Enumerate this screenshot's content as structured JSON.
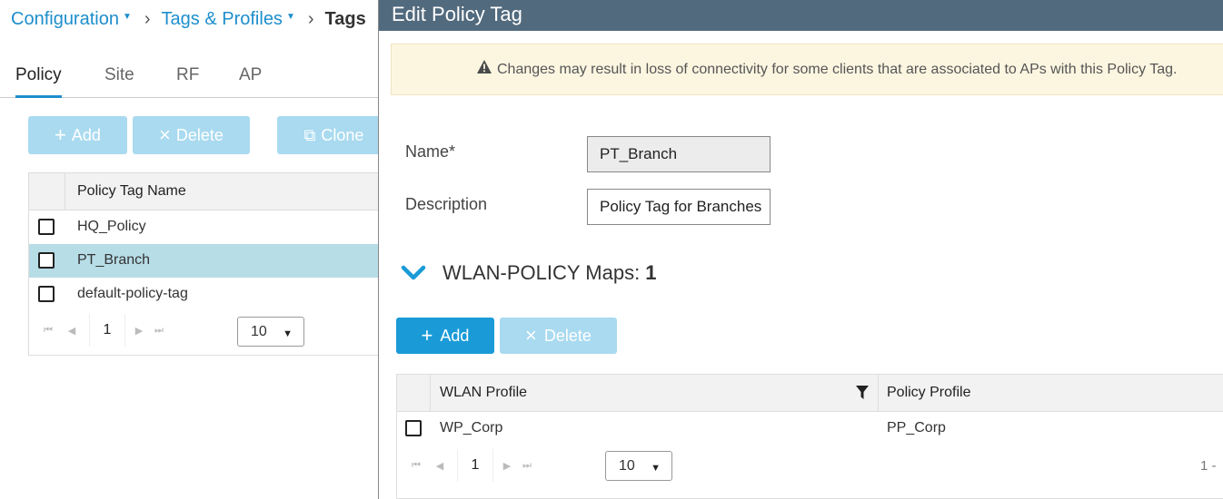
{
  "breadcrumb": {
    "items": [
      "Configuration",
      "Tags & Profiles"
    ],
    "current": "Tags"
  },
  "tabs": [
    "Policy",
    "Site",
    "RF",
    "AP"
  ],
  "active_tab": "Policy",
  "list_toolbar": {
    "add_label": "Add",
    "delete_label": "Delete",
    "clone_label": "Clone"
  },
  "list_table": {
    "header": "Policy Tag Name",
    "rows": [
      "HQ_Policy",
      "PT_Branch",
      "default-policy-tag"
    ],
    "selected_row": "PT_Branch",
    "page": "1",
    "page_size": "10"
  },
  "modal": {
    "title": "Edit Policy Tag",
    "warning": "Changes may result in loss of connectivity for some clients that are associated to APs with this Policy Tag.",
    "name_label": "Name*",
    "name_value": "PT_Branch",
    "description_label": "Description",
    "description_value": "Policy Tag for Branches",
    "section_title": "WLAN-POLICY Maps:",
    "section_count": "1",
    "add_label": "Add",
    "delete_label": "Delete",
    "table": {
      "columns": [
        "WLAN Profile",
        "Policy Profile"
      ],
      "rows": [
        {
          "wlan_profile": "WP_Corp",
          "policy_profile": "PP_Corp"
        }
      ],
      "page": "1",
      "page_size": "10",
      "item_count_text": "1 -"
    }
  },
  "colors": {
    "accent": "#1a9bd7",
    "disabled_button": "#a9daf0",
    "modal_header": "#526a7d",
    "selected_row": "#b7dde7",
    "warning_bg": "#fcf6e1"
  }
}
